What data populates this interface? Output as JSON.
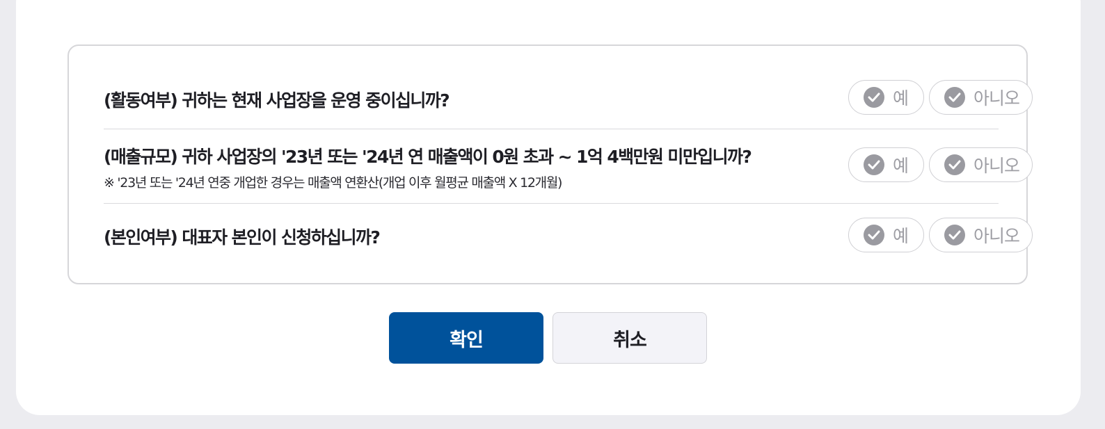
{
  "questions": [
    {
      "text": "(활동여부) 귀하는 현재 사업장을 운영 중이십니까?",
      "note": "",
      "yes_label": "예",
      "no_label": "아니오"
    },
    {
      "text": "(매출규모) 귀하 사업장의 '23년 또는 '24년 연 매출액이 0원 초과 ~ 1억 4백만원 미만입니까?",
      "note": "※ '23년 또는 '24년 연중 개업한 경우는 매출액 연환산(개업 이후 월평균 매출액 X 12개월)",
      "yes_label": "예",
      "no_label": "아니오"
    },
    {
      "text": "(본인여부) 대표자 본인이 신청하십니까?",
      "note": "",
      "yes_label": "예",
      "no_label": "아니오"
    }
  ],
  "actions": {
    "confirm_label": "확인",
    "cancel_label": "취소"
  },
  "icons": {
    "option_check": "check-circle-icon"
  },
  "colors": {
    "primary": "#00529b",
    "check_inactive": "#9a9aa0",
    "option_text_inactive": "#9e9ea4"
  }
}
